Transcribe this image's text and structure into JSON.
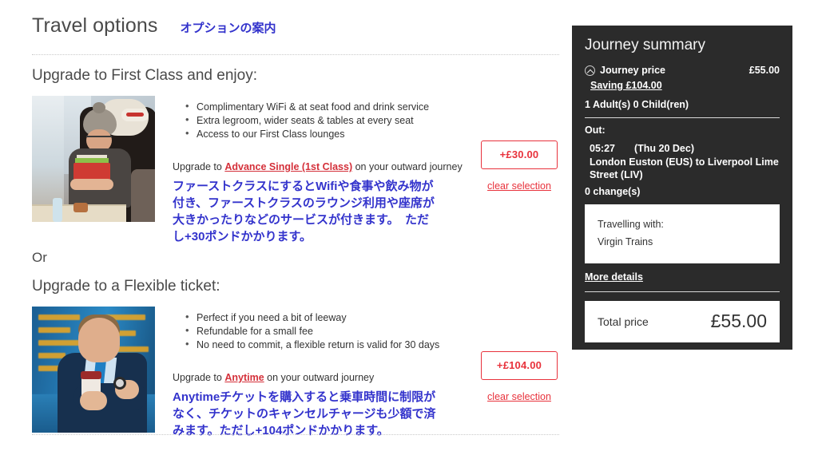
{
  "page": {
    "title": "Travel options",
    "title_jp": "オプションの案内"
  },
  "offers": [
    {
      "heading": "Upgrade to First Class and enjoy:",
      "photo_name": "first-class-passenger-photo",
      "perks": [
        "Complimentary WiFi & at seat food and drink service",
        "Extra legroom, wider seats & tables at every seat",
        "Access to our First Class lounges"
      ],
      "upgrade_prefix": "Upgrade to ",
      "upgrade_link": "Advance Single (1st Class)",
      "upgrade_suffix": " on your outward journey",
      "jp_desc": "ファーストクラスにするとWifiや食事や飲み物が付き、ファーストクラスのラウンジ利用や座席が大きかったりなどのサービスが付きます。　ただし+30ポンドかかります。",
      "price": "+£30.00",
      "clear_label": "clear selection"
    },
    {
      "or_label": "Or",
      "heading": "Upgrade to a Flexible ticket:",
      "photo_name": "flexible-ticket-traveller-photo",
      "perks": [
        "Perfect if you need a bit of leeway",
        "Refundable for a small fee",
        "No need to commit, a flexible return is valid for 30 days"
      ],
      "upgrade_prefix": "Upgrade to ",
      "upgrade_link": "Anytime",
      "upgrade_suffix": " on your outward journey",
      "jp_desc": "Anytimeチケットを購入すると乗車時間に制限がなく、チケットのキャンセルチャージも少額で済みます。ただし+104ポンドかかります。",
      "price": "+£104.00",
      "clear_label": "clear selection"
    }
  ],
  "summary": {
    "title": "Journey summary",
    "journey_price_label": "Journey price",
    "journey_price_value": "£55.00",
    "saving_label": "Saving £104.00",
    "passengers": "1 Adult(s) 0 Child(ren)",
    "out_label": "Out:",
    "depart_time": "05:27",
    "depart_date": "(Thu 20 Dec)",
    "route": "London Euston (EUS) to Liverpool Lime Street (LIV)",
    "changes": "0 change(s)",
    "operator_label": "Travelling with:",
    "operator_name": "Virgin Trains",
    "more_details_label": "More details",
    "total_label": "Total price",
    "total_value": "£55.00"
  },
  "colors": {
    "accent_red": "#e8323c",
    "link_red": "#d4303a",
    "jp_blue": "#3333cc",
    "panel_dark": "#2b2b2b"
  }
}
